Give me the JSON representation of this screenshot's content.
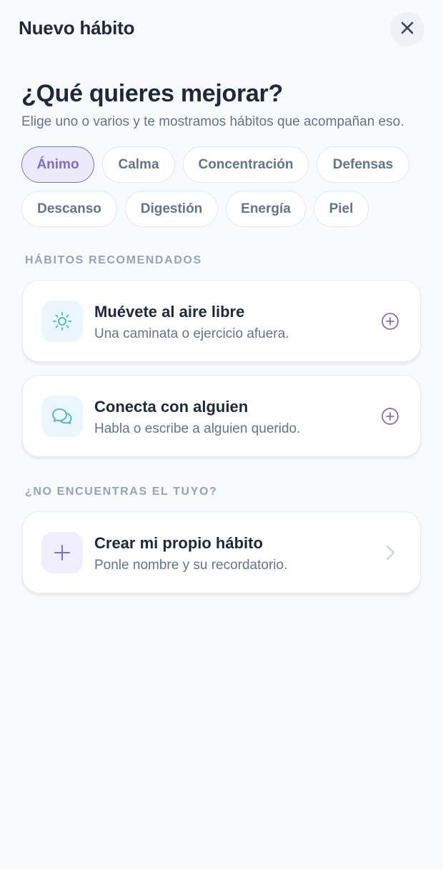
{
  "header": {
    "title": "Nuevo hábito",
    "close_icon": "close-icon"
  },
  "intro": {
    "title": "¿Qué quieres mejorar?",
    "subtitle": "Elige uno o varios y te mostramos hábitos que acompañan eso."
  },
  "categories": [
    {
      "label": "Ánimo",
      "selected": true
    },
    {
      "label": "Calma",
      "selected": false
    },
    {
      "label": "Concentración",
      "selected": false
    },
    {
      "label": "Defensas",
      "selected": false
    },
    {
      "label": "Descanso",
      "selected": false
    },
    {
      "label": "Digestión",
      "selected": false
    },
    {
      "label": "Energía",
      "selected": false
    },
    {
      "label": "Piel",
      "selected": false
    }
  ],
  "recommended": {
    "section_label": "HÁBITOS RECOMENDADOS",
    "items": [
      {
        "title": "Muévete al aire libre",
        "description": "Una caminata o ejercicio afuera.",
        "icon": "sun-icon",
        "action_icon": "add-circle-icon"
      },
      {
        "title": "Conecta con alguien",
        "description": "Habla o escribe a alguien querido.",
        "icon": "chat-bubbles-icon",
        "action_icon": "add-circle-icon"
      }
    ]
  },
  "custom": {
    "section_label": "¿NO ENCUENTRAS EL TUYO?",
    "title": "Crear mi propio hábito",
    "description": "Ponle nombre y su recordatorio.",
    "icon": "plus-icon",
    "action_icon": "chevron-right-icon"
  },
  "colors": {
    "background": "#f8fafc",
    "accent": "#7a6fcf",
    "accent_soft": "#ece9fb",
    "teal": "#3fb6c3",
    "teal_soft": "#eaf6fb",
    "text_primary": "#1e293b",
    "text_secondary": "#64748b",
    "section_label": "#94a3b8"
  }
}
